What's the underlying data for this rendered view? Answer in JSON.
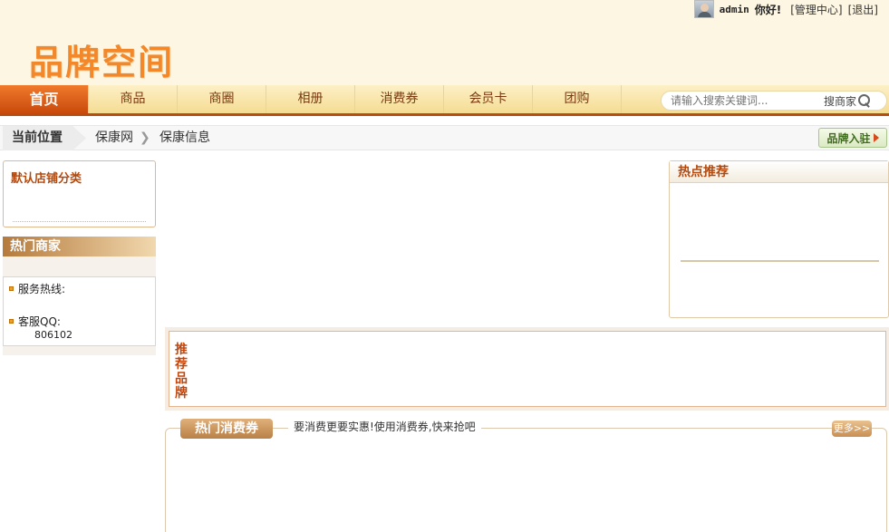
{
  "topbar": {
    "username": "admin",
    "greeting": "你好!",
    "admin_link": "[管理中心]",
    "logout_link": "[退出]"
  },
  "header": {
    "logo_text": "品牌空间"
  },
  "nav": {
    "items": [
      {
        "label": "首页",
        "active": true
      },
      {
        "label": "商品"
      },
      {
        "label": "商圈"
      },
      {
        "label": "相册"
      },
      {
        "label": "消费券"
      },
      {
        "label": "会员卡"
      },
      {
        "label": "团购"
      }
    ],
    "search_placeholder": "请输入搜索关键词...",
    "search_button": "搜商家"
  },
  "breadcrumb": {
    "head": "当前位置",
    "items": [
      "保康网",
      "保康信息"
    ],
    "brand_entry_label": "品牌入驻"
  },
  "sidebar": {
    "category_title": "默认店铺分类",
    "hot_merchants_title": "热门商家",
    "service_hotline_label": "服务热线:",
    "qq_label": "客服QQ:",
    "qq_value": "806102"
  },
  "hot_recommend": {
    "title": "热点推荐"
  },
  "recommended_brands": {
    "title": "推荐品牌"
  },
  "hot_coupons": {
    "title": "热门消费券",
    "slogan": "要消费更要实惠!使用消费券,快来抢吧",
    "more_label": "更多>>"
  },
  "colors": {
    "accent": "#c94a0c",
    "nav_bg": "#f5dc92",
    "header_bg": "#fdf6e2"
  }
}
